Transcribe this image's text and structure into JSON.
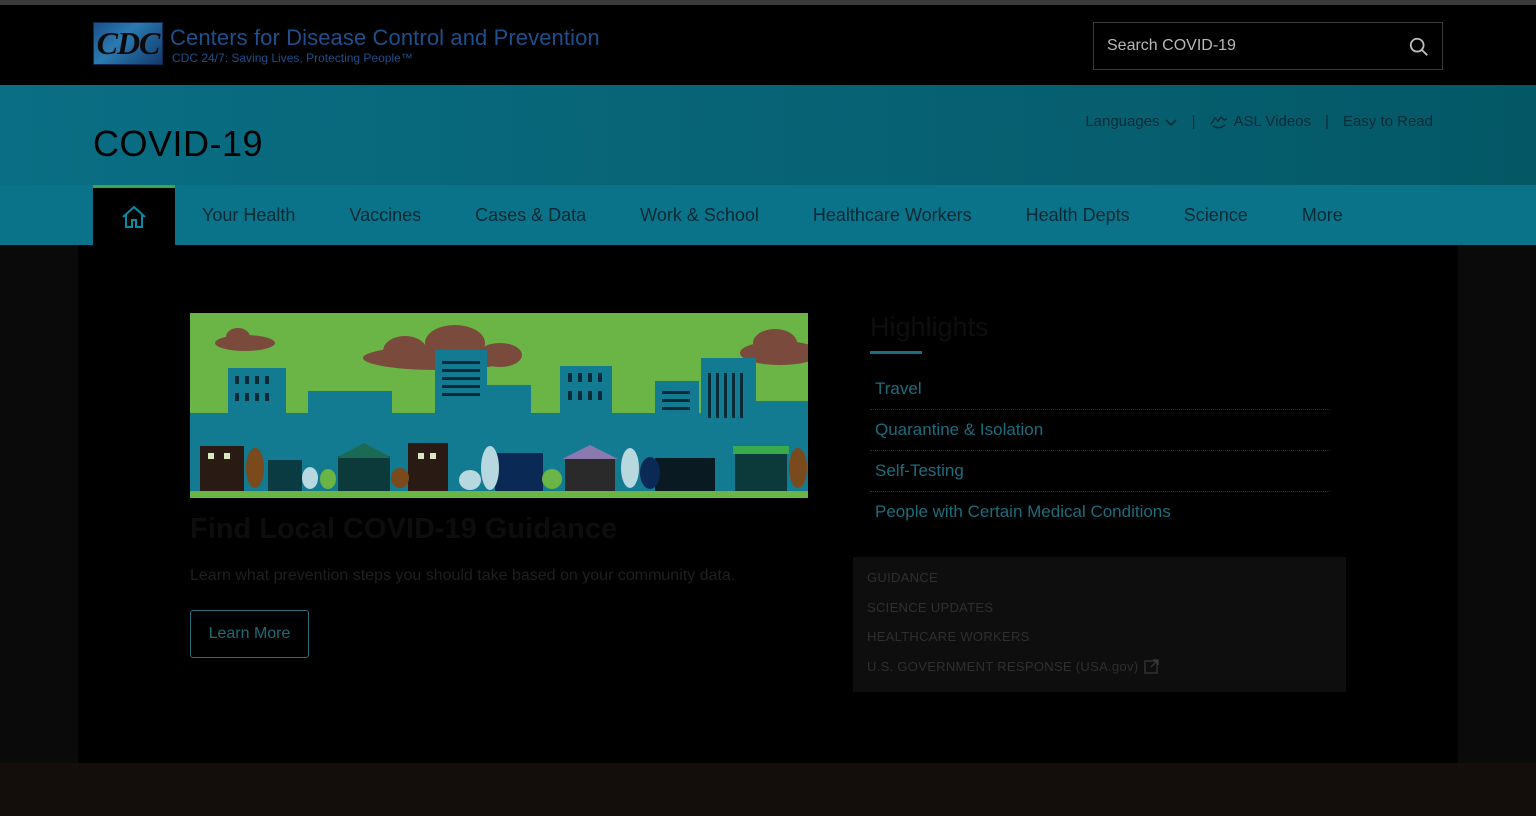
{
  "header": {
    "logo_text": "CDC",
    "org_name": "Centers for Disease Control and Prevention",
    "tagline": "CDC 24/7: Saving Lives, Protecting People™",
    "search_placeholder": "Search COVID-19"
  },
  "title_band": {
    "page_title": "COVID-19",
    "links": {
      "languages": "Languages",
      "asl": "ASL Videos",
      "easy_read": "Easy to Read"
    },
    "separator": "|"
  },
  "nav": {
    "home_icon": "home-icon",
    "items": [
      "Your Health",
      "Vaccines",
      "Cases & Data",
      "Work & School",
      "Healthcare Workers",
      "Health Depts",
      "Science",
      "More"
    ]
  },
  "hero": {
    "title": "Find Local COVID-19 Guidance",
    "description": "Learn what prevention steps you should take based on your community data.",
    "button": "Learn More"
  },
  "highlights": {
    "title": "Highlights",
    "items": [
      "Travel",
      "Quarantine & Isolation",
      "Self-Testing",
      "People with Certain Medical Conditions"
    ]
  },
  "guidance": {
    "items": [
      "GUIDANCE",
      "SCIENCE UPDATES",
      "HEALTHCARE WORKERS",
      "U.S. GOVERNMENT RESPONSE (USA.gov)"
    ]
  },
  "colors": {
    "band": "#0a6e84",
    "nav": "#0a7389",
    "accent_green": "#39a84c",
    "link": "#1c6d7c"
  }
}
